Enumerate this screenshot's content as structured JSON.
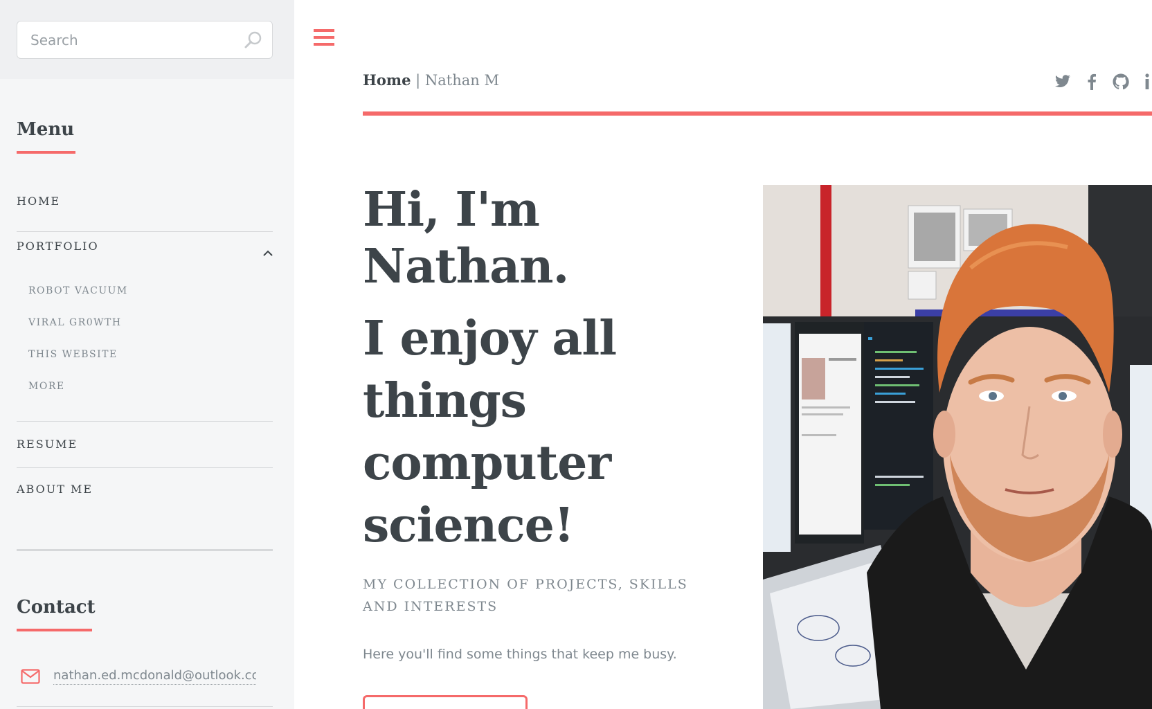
{
  "search": {
    "placeholder": "Search",
    "icon": "search-icon"
  },
  "sidebar": {
    "menu_heading": "Menu",
    "items": [
      {
        "label": "HOME"
      },
      {
        "label": "PORTFOLIO",
        "expanded": true,
        "subitems": [
          {
            "label": "ROBOT VACUUM"
          },
          {
            "label": "VIRAL GR0WTH"
          },
          {
            "label": "THIS WEBSITE"
          },
          {
            "label": "MORE"
          }
        ]
      },
      {
        "label": "RESUME"
      },
      {
        "label": "ABOUT ME"
      }
    ],
    "contact_heading": "Contact",
    "contact_email": "nathan.ed.mcdonald@outlook.com",
    "contact_icon": "envelope-icon"
  },
  "header": {
    "menu_icon": "hamburger-icon",
    "breadcrumb_home": "Home",
    "breadcrumb_separator": "|",
    "breadcrumb_current": "Nathan M",
    "social": [
      "twitter-icon",
      "facebook-icon",
      "github-icon",
      "info-icon"
    ]
  },
  "hero": {
    "title": "Hi, I'm Nathan.",
    "title_2": "I enjoy all things computer science!",
    "subtitle": "MY COLLECTION OF PROJECTS, SKILLS AND INTERESTS",
    "text": "Here you'll find some things that keep me busy."
  },
  "colors": {
    "accent": "#f56a6a",
    "text_dark": "#3d4449",
    "text_muted": "#7f888f",
    "sidebar_bg": "#f5f6f7"
  }
}
